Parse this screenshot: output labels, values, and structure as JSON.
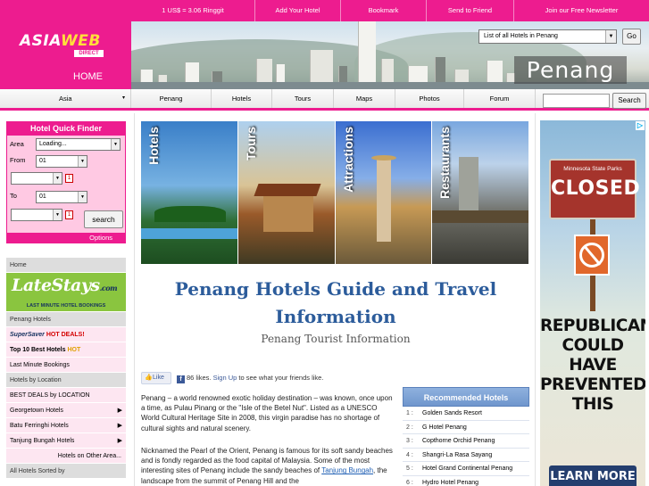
{
  "logo": {
    "part1": "ASIA",
    "part2": "WEB",
    "part3": "DIRECT"
  },
  "home_label": "HOME",
  "topnav": [
    "1 US$ = 3.06 Ringgit",
    "Add Your Hotel",
    "Bookmark",
    "Send to Friend",
    "Join our Free Newsletter"
  ],
  "banner": {
    "hotel_select": "List of all Hotels in Penang",
    "go_label": "Go",
    "city_word": "Penang"
  },
  "nav2": {
    "region": "Asia",
    "items": [
      "Penang",
      "Hotels",
      "Tours",
      "Maps",
      "Photos",
      "Forum"
    ],
    "search_label": "Search",
    "search_value": ""
  },
  "finder": {
    "title": "Hotel Quick Finder",
    "area_label": "Area",
    "area_value": "Loading...",
    "from_label": "From",
    "from_day": "01",
    "from_month": "",
    "to_label": "To",
    "to_day": "01",
    "to_month": "",
    "calendar_glyph": "1",
    "search_label": "search",
    "options_label": "Options"
  },
  "leftmenu": {
    "home": "Home",
    "latestays_brand": "LateStays",
    "latestays_dotcom": ".com",
    "latestays_tagline": "LAST MINUTE HOTEL BOOKINGS",
    "penang_hotels": "Penang Hotels",
    "supersaver": "SuperSaver",
    "hot_deals": "HOT DEALS!",
    "top10": "Top 10 Best Hotels",
    "hot": "HOT",
    "last_minute": "Last Minute Bookings",
    "by_location": "Hotels by Location",
    "best_deals": "BEST DEALS by LOCATION",
    "georgetown": "Georgetown Hotels",
    "batu": "Batu Ferringhi Hotels",
    "tanjung": "Tanjung Bungah Hotels",
    "other_area": "Hotels on Other Area...",
    "sorted": "All Hotels Sorted by"
  },
  "tiles": [
    "Hotels",
    "Tours",
    "Attractions",
    "Restaurants"
  ],
  "main": {
    "title": "Penang Hotels Guide and Travel Information",
    "subtitle": "Penang Tourist Information",
    "like_label": "Like",
    "like_count": "86 likes.",
    "signup_label": "Sign Up",
    "signup_rest": "to see what your friends like.",
    "para1": "Penang – a world renowned exotic holiday destination – was known, once upon a time, as Pulau Pinang or the \"Isle of the Betel Nut\". Listed as a UNESCO World Cultural Heritage Site in 2008, this virgin paradise has no shortage of cultural sights and natural scenery.",
    "para2_a": "Nicknamed the Pearl of the Orient, Penang is famous for its soft sandy beaches and is fondly regarded as the food capital of Malaysia. Some of the most interesting sites of Penang include the sandy beaches of",
    "para2_link": "Tanjung Bungah",
    "para2_b": ", the landscape from the summit of Penang Hill and the"
  },
  "recommended": {
    "title": "Recommended Hotels",
    "items": [
      {
        "num": "1 :",
        "name": "Golden Sands Resort"
      },
      {
        "num": "2 :",
        "name": "G Hotel Penang"
      },
      {
        "num": "3 :",
        "name": "Copthorne Orchid Penang"
      },
      {
        "num": "4 :",
        "name": "Shangri-La Rasa Sayang"
      },
      {
        "num": "5 :",
        "name": "Hotel Grand Continental Penang"
      },
      {
        "num": "6 :",
        "name": "Hydro Hotel Penang"
      }
    ]
  },
  "ad": {
    "corner": "▷",
    "sign_top": "Minnesota State Parks",
    "sign_main": "CLOSED",
    "headline": "REPUBLICANS COULD HAVE PREVENTED THIS",
    "button": "LEARN MORE"
  }
}
